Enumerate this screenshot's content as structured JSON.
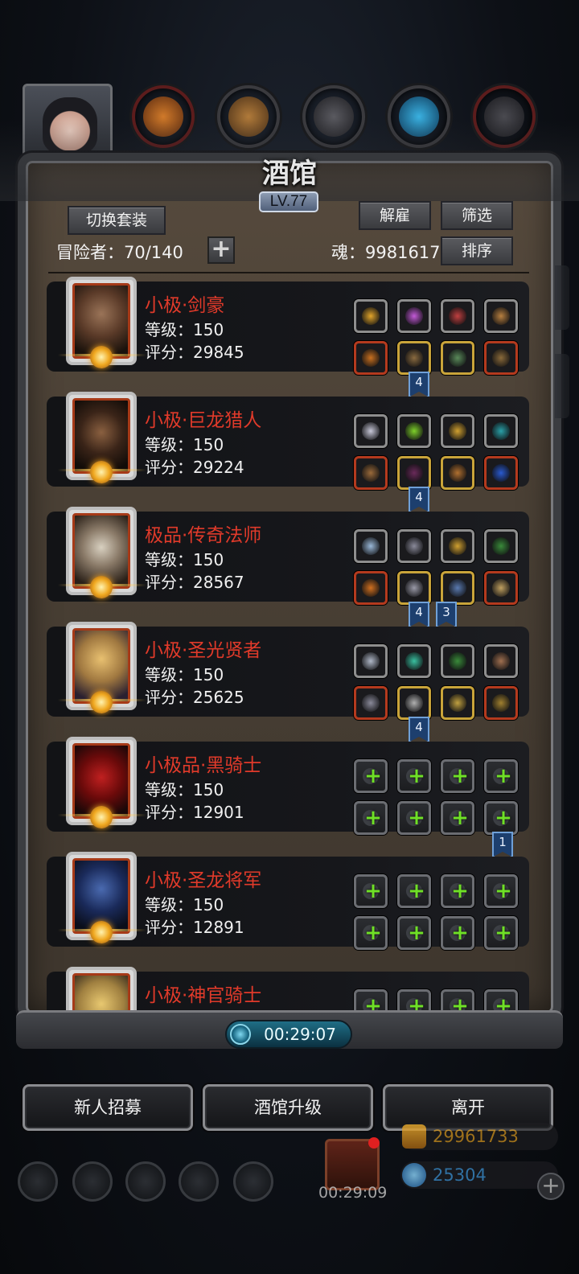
{
  "window": {
    "title": "酒馆",
    "level": "LV.77"
  },
  "header": {
    "switch_outfit": "切换套装",
    "dismiss": "解雇",
    "filter": "筛选",
    "sort": "排序",
    "adventurers": "冒险者：70/140",
    "add_icon": "+",
    "soul": "魂：9981617"
  },
  "heroes": [
    {
      "name": "小极·剑豪",
      "level": "等级：150",
      "score": "评分：29845",
      "equipment": [
        {
          "icon": "crown-icon",
          "color": "#e2a52a"
        },
        {
          "icon": "gem-pink-icon",
          "color": "#c45ad8"
        },
        {
          "icon": "horn-icon",
          "color": "#c04040"
        },
        {
          "icon": "necklace-icon",
          "color": "#b88040"
        },
        {
          "icon": "sword-icon",
          "color": "#c87020"
        },
        {
          "icon": "armor-icon",
          "color": "#8a6b40"
        },
        {
          "icon": "ring-icon",
          "color": "#5a8a5a"
        },
        {
          "icon": "potion-icon",
          "color": "#8a6a3a"
        }
      ],
      "badges": [
        "4"
      ]
    },
    {
      "name": "小极·巨龙猎人",
      "level": "等级：150",
      "score": "评分：29224",
      "equipment": [
        {
          "icon": "wing-helmet-icon",
          "color": "#c8c8d8"
        },
        {
          "icon": "leaf-gem-icon",
          "color": "#7ed02a"
        },
        {
          "icon": "lantern-icon",
          "color": "#d0a030"
        },
        {
          "icon": "teal-stone-icon",
          "color": "#2aa0a8"
        },
        {
          "icon": "musket-icon",
          "color": "#9a6a3a"
        },
        {
          "icon": "cloak-icon",
          "color": "#6a2a5a"
        },
        {
          "icon": "pendant-icon",
          "color": "#b07030"
        },
        {
          "icon": "sapphire-icon",
          "color": "#2a5ad0"
        }
      ],
      "badges": [
        "4"
      ]
    },
    {
      "name": "极品·传奇法师",
      "level": "等级：150",
      "score": "评分：28567",
      "equipment": [
        {
          "icon": "frost-helmet-icon",
          "color": "#9ab8d8"
        },
        {
          "icon": "ore-icon",
          "color": "#8a8a9a"
        },
        {
          "icon": "lantern-icon",
          "color": "#d0a030"
        },
        {
          "icon": "shield-green-icon",
          "color": "#3a8a3a"
        },
        {
          "icon": "staff-icon",
          "color": "#d07020"
        },
        {
          "icon": "chest-plate-icon",
          "color": "#9a9aa8"
        },
        {
          "icon": "wand-icon",
          "color": "#5a7ab0"
        },
        {
          "icon": "mask-icon",
          "color": "#c0a060"
        }
      ],
      "badges": [
        "4",
        "3"
      ]
    },
    {
      "name": "小极·圣光贤者",
      "level": "等级：150",
      "score": "评分：25625",
      "equipment": [
        {
          "icon": "silver-helmet-icon",
          "color": "#b0b8c8"
        },
        {
          "icon": "orb-icon",
          "color": "#3ac0a0"
        },
        {
          "icon": "shield-green-icon",
          "color": "#3a8a3a"
        },
        {
          "icon": "slingshot-icon",
          "color": "#a07050"
        },
        {
          "icon": "hammer-icon",
          "color": "#8a8a9a"
        },
        {
          "icon": "vest-icon",
          "color": "#b0b0b0"
        },
        {
          "icon": "crown-dark-icon",
          "color": "#c0a040"
        },
        {
          "icon": "amulet-icon",
          "color": "#a08030"
        }
      ],
      "badges": [
        "4"
      ]
    },
    {
      "name": "小极品·黑骑士",
      "level": "等级：150",
      "score": "评分：12901",
      "equipment": "empty",
      "badges": [
        "1"
      ]
    },
    {
      "name": "小极·圣龙将军",
      "level": "等级：150",
      "score": "评分：12891",
      "equipment": "empty",
      "badges": []
    },
    {
      "name": "小极·神官骑士",
      "level": "",
      "score": "",
      "equipment": "empty",
      "badges": []
    }
  ],
  "timer": "00:29:07",
  "actions": {
    "recruit": "新人招募",
    "upgrade": "酒馆升级",
    "leave": "离开"
  },
  "hud": {
    "gift_timer": "00:29:09",
    "gold": "29961733",
    "gems": "25304",
    "add_icon": "+"
  },
  "colors": {
    "hero_name": "#e03a2a",
    "panel": "#4a4035",
    "timer_bg": "#1f6e86"
  }
}
